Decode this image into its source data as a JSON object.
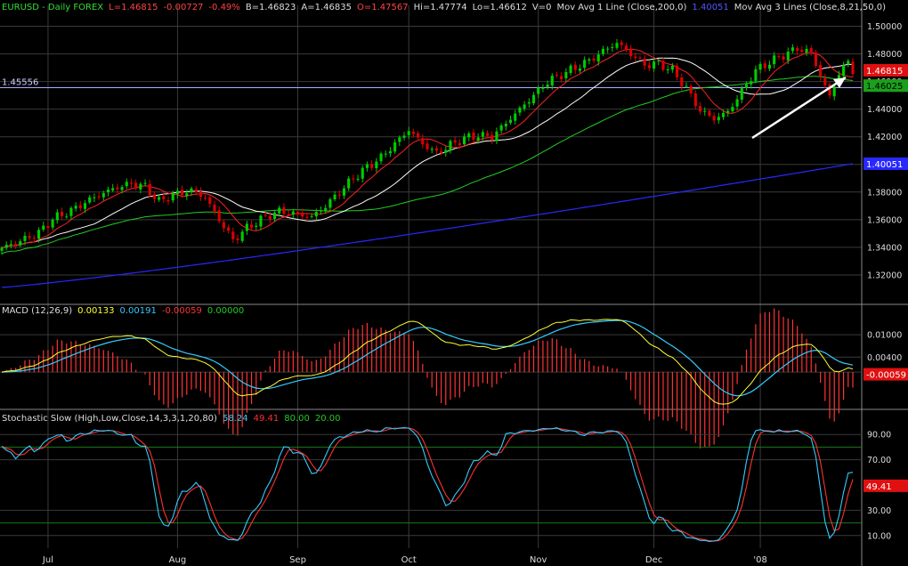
{
  "header": {
    "symbol": "EURUSD - Daily FOREX",
    "last": "L=1.46815",
    "change": "-0.00727",
    "change_pct": "-0.49%",
    "bid": "B=1.46823",
    "ask": "A=1.46835",
    "open": "O=1.47567",
    "high": "Hi=1.47774",
    "low": "Lo=1.46612",
    "volume": "V=0",
    "ma1_label": "Mov Avg 1 Line (Close,200,0)",
    "ma1_value": "1.40051",
    "ma3_label": "Mov Avg 3 Lines (Close,8,21,50,0)"
  },
  "macd_header": {
    "label": "MACD (12,26,9)",
    "macd": "0.00133",
    "signal": "0.00191",
    "hist": "-0.00059",
    "zero": "0.00000"
  },
  "stoch_header": {
    "label": "Stochastic Slow (High,Low,Close,14,3,3,1,20,80)",
    "k": "58.24",
    "d": "49.41",
    "upper": "80.00",
    "lower": "20.00"
  },
  "colors": {
    "background": "#000000",
    "up_candle": "#00cc00",
    "down_candle": "#dd0000",
    "ma8": "#ff2020",
    "ma21": "#ffffff",
    "ma50": "#22cc22",
    "ma200": "#2828ff",
    "macd_line": "#ffff33",
    "signal_line": "#33ccff",
    "histogram": "#ff3333",
    "stoch_k": "#33ccff",
    "stoch_d": "#ff3030",
    "grid": "#3a3a3a",
    "horiz_line": "#aaaaff"
  },
  "chart_data": {
    "type": "candlestick",
    "symbol": "EURUSD",
    "timeframe": "Daily",
    "price_axis": {
      "min": 1.3,
      "max": 1.51,
      "ticks": [
        "1.50000",
        "1.48000",
        "1.46000",
        "1.44000",
        "1.42000",
        "1.40000",
        "1.38000",
        "1.36000",
        "1.34000",
        "1.32000"
      ],
      "tick_values": [
        1.5,
        1.48,
        1.46,
        1.44,
        1.42,
        1.4,
        1.38,
        1.36,
        1.34,
        1.32
      ]
    },
    "x_axis": {
      "month_labels": [
        "Jul",
        "Aug",
        "Sep",
        "Oct",
        "Nov",
        "Dec",
        "'08"
      ],
      "month_start_index": [
        10,
        38,
        64,
        88,
        116,
        141,
        164
      ]
    },
    "horizontal_line": {
      "value": 1.45556,
      "label": "1.45556"
    },
    "last_price_tag": "1.46815",
    "ma200_tag": "1.40051",
    "ma_tag_hidden": "1.46025",
    "close_anchors": [
      [
        0,
        1.3395
      ],
      [
        4,
        1.3445
      ],
      [
        8,
        1.3505
      ],
      [
        11,
        1.3605
      ],
      [
        15,
        1.3665
      ],
      [
        19,
        1.3745
      ],
      [
        22,
        1.3795
      ],
      [
        25,
        1.3835
      ],
      [
        28,
        1.386
      ],
      [
        31,
        1.384
      ],
      [
        34,
        1.373
      ],
      [
        37,
        1.378
      ],
      [
        41,
        1.381
      ],
      [
        44,
        1.376
      ],
      [
        47,
        1.36
      ],
      [
        50,
        1.345
      ],
      [
        53,
        1.354
      ],
      [
        57,
        1.362
      ],
      [
        60,
        1.366
      ],
      [
        64,
        1.364
      ],
      [
        67,
        1.362
      ],
      [
        70,
        1.37
      ],
      [
        73,
        1.38
      ],
      [
        76,
        1.39
      ],
      [
        79,
        1.398
      ],
      [
        82,
        1.405
      ],
      [
        85,
        1.415
      ],
      [
        88,
        1.425
      ],
      [
        91,
        1.415
      ],
      [
        94,
        1.408
      ],
      [
        97,
        1.414
      ],
      [
        100,
        1.419
      ],
      [
        103,
        1.421
      ],
      [
        106,
        1.42
      ],
      [
        109,
        1.43
      ],
      [
        112,
        1.44
      ],
      [
        115,
        1.45
      ],
      [
        118,
        1.46
      ],
      [
        121,
        1.465
      ],
      [
        124,
        1.47
      ],
      [
        127,
        1.475
      ],
      [
        130,
        1.482
      ],
      [
        133,
        1.488
      ],
      [
        136,
        1.48
      ],
      [
        139,
        1.472
      ],
      [
        142,
        1.473
      ],
      [
        145,
        1.468
      ],
      [
        148,
        1.455
      ],
      [
        151,
        1.439
      ],
      [
        154,
        1.433
      ],
      [
        157,
        1.438
      ],
      [
        160,
        1.453
      ],
      [
        163,
        1.468
      ],
      [
        166,
        1.474
      ],
      [
        169,
        1.479
      ],
      [
        172,
        1.484
      ],
      [
        175,
        1.481
      ],
      [
        177,
        1.464
      ],
      [
        179,
        1.449
      ],
      [
        181,
        1.466
      ],
      [
        183,
        1.474
      ],
      [
        184,
        1.4682
      ]
    ],
    "macd_panel": {
      "range": [
        -0.0095,
        0.0155
      ],
      "ticks": [
        "0.01000",
        "0.00400"
      ],
      "tick_values": [
        0.01,
        0.004
      ],
      "last_tag": "-0.00059"
    },
    "stochastic_panel": {
      "range": [
        0,
        100
      ],
      "ticks": [
        "90.00",
        "70.00",
        "30.00",
        "10.00"
      ],
      "tick_values": [
        90,
        70,
        30,
        10
      ],
      "levels": [
        80,
        20
      ],
      "last_tag": "49.41"
    },
    "annotation": "white arrow pointing up-right near last price"
  }
}
